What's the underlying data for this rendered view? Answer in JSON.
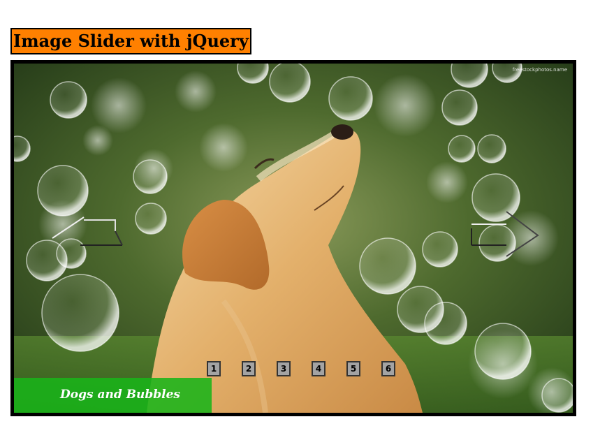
{
  "page": {
    "title": "Image Slider with jQuery"
  },
  "slider": {
    "watermark": "freestockphotos.name",
    "caption": "Dogs and Bubbles",
    "prev_icon": "arrow-left-icon",
    "next_icon": "arrow-right-icon",
    "pages": [
      "1",
      "2",
      "3",
      "4",
      "5",
      "6"
    ],
    "active_page": "1"
  },
  "colors": {
    "title_background": "#ff8000",
    "caption_background": "#19b419",
    "pager_background": "#a3a3a3",
    "frame_border": "#000000"
  }
}
